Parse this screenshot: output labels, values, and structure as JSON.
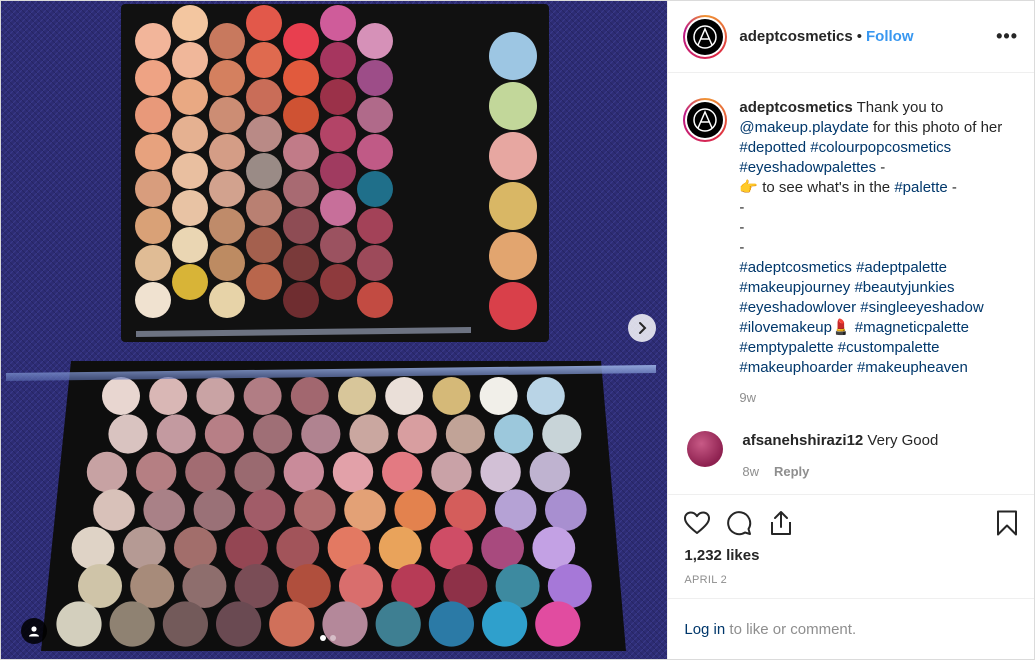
{
  "post": {
    "username": "adeptcosmetics",
    "follow_label": "Follow",
    "more_icon": "more-horizontal-icon",
    "caption": {
      "username": "adeptcosmetics",
      "text_1": " Thank you to ",
      "mention": "@makeup.playdate",
      "text_2": " for this photo of her ",
      "tags_1": [
        "#depotted",
        "#colourpopcosmetics",
        "#eyeshadowpalettes"
      ],
      "tags_1_suffix": " -",
      "pointer_emoji": "👉",
      "text_3": " to see what's in the ",
      "tag_palette": "#palette",
      "text_3_suffix": " -",
      "dash_lines": [
        "-",
        "-",
        "-"
      ],
      "tags_2": [
        "#adeptcosmetics",
        "#adeptpalette",
        "#makeupjourney",
        "#beautyjunkies",
        "#eyeshadowlover",
        "#singleeyeshadow",
        "#ilovemakeup"
      ],
      "lipstick_emoji": "💄",
      "tags_3": [
        "#magneticpalette",
        "#emptypalette",
        "#custompalette",
        "#makeuphoarder",
        "#makeupheaven"
      ],
      "time": "9w"
    },
    "comments": [
      {
        "username": "afsanehshirazi12",
        "text": " Very Good",
        "time": "8w",
        "reply_label": "Reply"
      }
    ],
    "likes": "1,232 likes",
    "date": "APRIL 2",
    "login_link": "Log in",
    "login_text": " to like or comment."
  },
  "media": {
    "carousel_dots": 2,
    "active_dot": 0
  }
}
